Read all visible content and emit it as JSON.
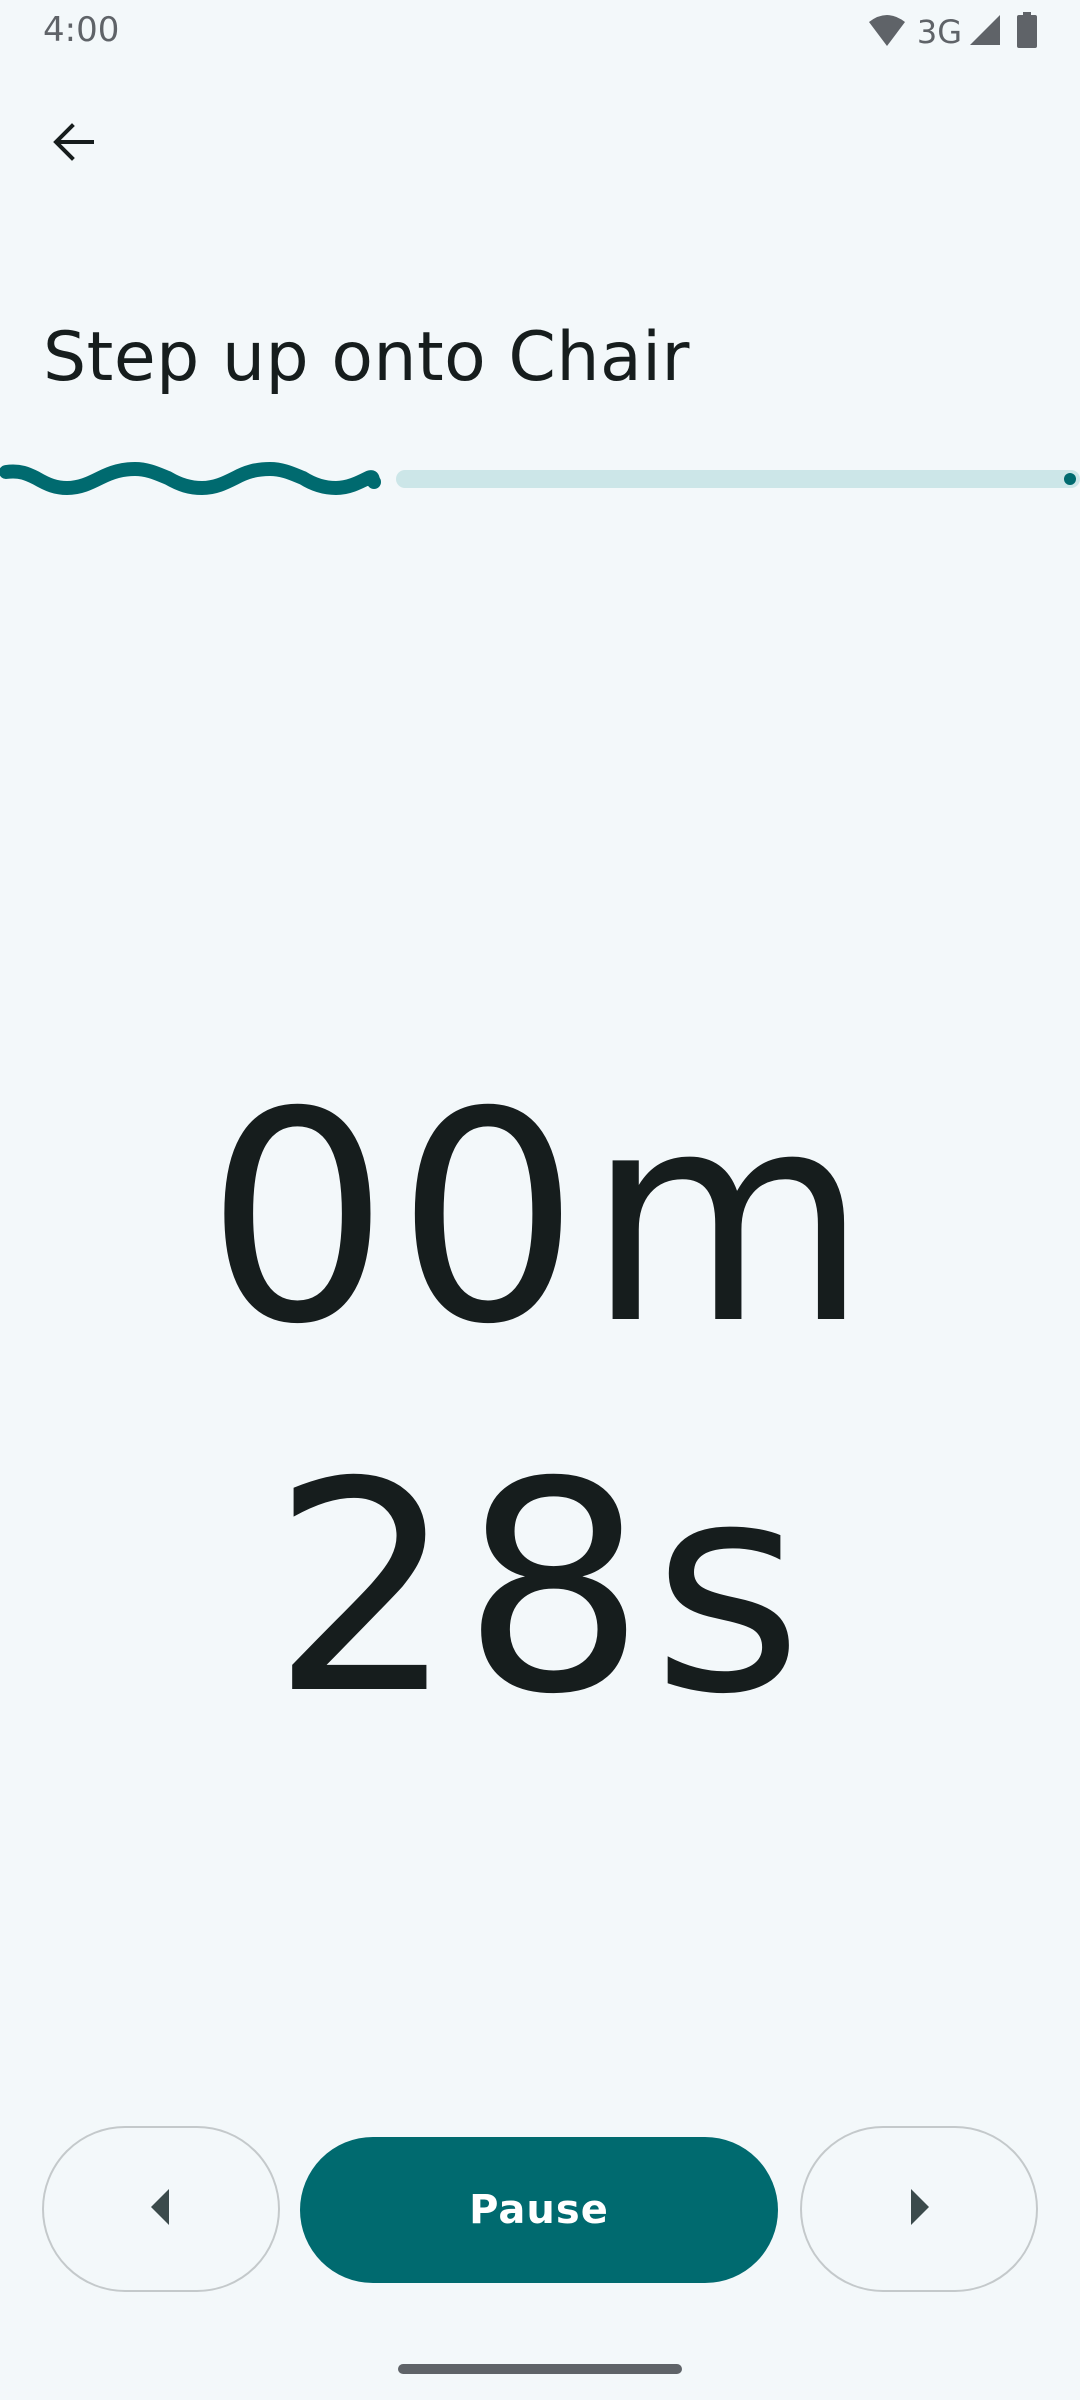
{
  "status_bar": {
    "time": "4:00",
    "network": "3G",
    "icons": [
      "wifi-icon",
      "cell-signal-icon",
      "battery-icon"
    ]
  },
  "header": {
    "back_icon": "arrow-back-icon",
    "title": "Step up onto Chair"
  },
  "progress": {
    "fraction": 0.35,
    "active_color": "#006a6f",
    "track_color": "#cce6e8"
  },
  "timer": {
    "minutes": "00m",
    "seconds": "28s"
  },
  "controls": {
    "previous_icon": "triangle-left-icon",
    "pause_label": "Pause",
    "next_icon": "triangle-right-icon",
    "accent_color": "#006a6f"
  }
}
